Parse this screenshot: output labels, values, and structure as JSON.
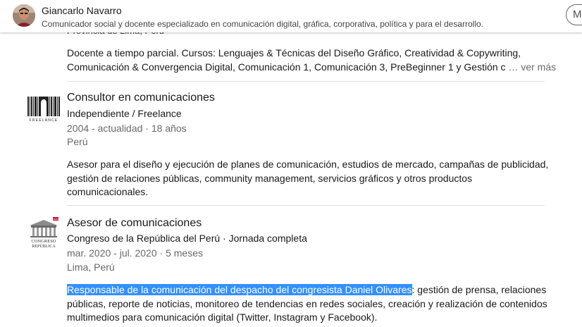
{
  "header": {
    "name": "Giancarlo Navarro",
    "headline": "Comunicador social y docente especializado en comunicación digital, gráfica, corporativa, política y para el desarrollo.",
    "more_button": "M"
  },
  "previous_entry": {
    "cut_text": "Provincia de Lima, Perú",
    "description_lines": [
      "Docente a tiempo parcial. Cursos: Lenguajes & Técnicas del Diseño Gráfico, Creatividad & Copywriting,",
      "Comunicación & Convergencia Digital, Comunicación 1, Comunicación 3, PreBeginner 1 y Gestión c"
    ],
    "ellipsis": "…",
    "see_more": "ver más"
  },
  "experiences": [
    {
      "title": "Consultor en comunicaciones",
      "company": "Independiente / Freelance",
      "dates": "2004 - actualidad · 18 años",
      "location": "Perú",
      "logo_text": "FREELANCE",
      "description_lines": [
        "Asesor para el diseño y ejecución de planes de comunicación, estudios de mercado, campañas de publicidad,",
        "gestión de relaciones públicas, community management, servicios gráficos y otros productos",
        "comunicacionales."
      ]
    },
    {
      "title": "Asesor de comunicaciones",
      "company": "Congreso de la República del Perú · Jornada completa",
      "dates": "mar. 2020 - jul. 2020 · 5 meses",
      "location": "Lima, Perú",
      "logo_text": [
        "PERÚ",
        "CONGRESO",
        "REPÚBLICA"
      ],
      "description_highlighted": "Responsable de la comunicación del despacho del congresista Daniel Olivares",
      "description_lines": [
        ": gestión de prensa, relaciones",
        "públicas, reporte de noticias, monitoreo de tendencias en redes sociales, creación y realización de contenidos",
        "multimedios para comunicación digital (Twitter, Instagram y Facebook)."
      ]
    }
  ],
  "colors": {
    "selection": "#3390ff",
    "divider": "#e0e0e0",
    "secondary_text": "#666666"
  }
}
